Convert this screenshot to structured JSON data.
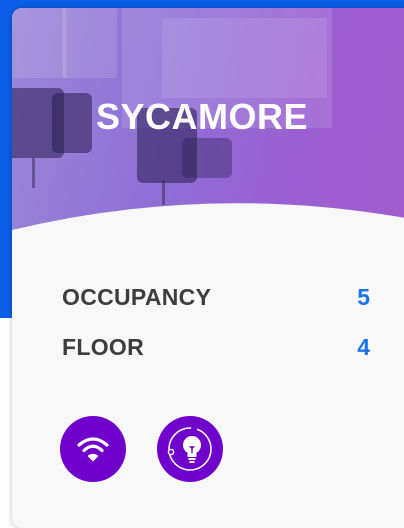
{
  "room": {
    "name": "SYCAMORE"
  },
  "details": [
    {
      "label": "OCCUPANCY",
      "value": "5"
    },
    {
      "label": "FLOOR",
      "value": "4"
    }
  ],
  "amenities": [
    {
      "icon": "wifi-icon"
    },
    {
      "icon": "light-bulb-icon"
    }
  ],
  "colors": {
    "accent_blue": "#1a73e8",
    "amenity_purple": "#7000cc",
    "label_gray": "#3d3d3d",
    "page_blue": "#0a5ee8"
  }
}
